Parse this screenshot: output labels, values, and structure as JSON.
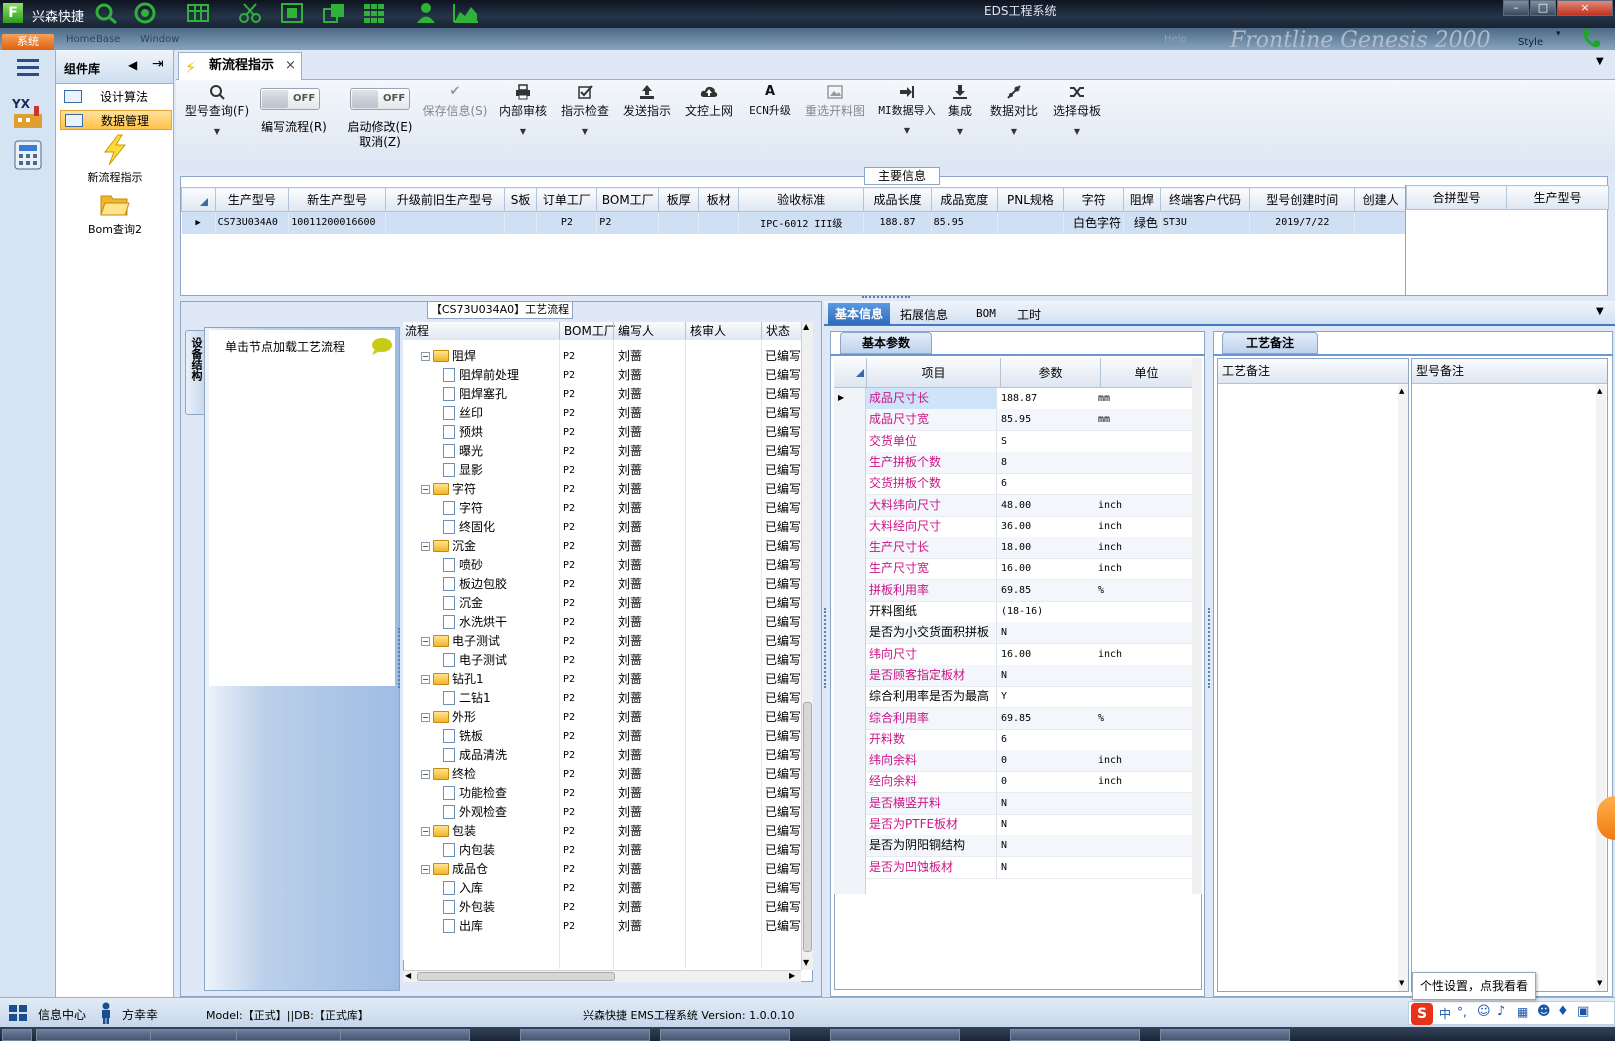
{
  "app": {
    "name": "兴森快捷",
    "window_title": "EDS工程系统",
    "window_buttons": [
      "–",
      "□",
      "×"
    ],
    "quick_icons": [
      "search-icon",
      "target-icon",
      "grid-icon",
      "scissors-icon",
      "film-icon",
      "copy-icon",
      "table-icon",
      "user-icon",
      "chart-icon"
    ]
  },
  "ribbon": {
    "system_tab": "系统",
    "menus": [
      "Home",
      "Base",
      "Window"
    ],
    "right_faded": "Help",
    "watermark": "Frontline  Genesis 2000",
    "style_label": "Style"
  },
  "left_toolbar": {
    "icons": [
      "menu-icon",
      "factory-icon",
      "calculator-icon"
    ],
    "factory_text": "YX"
  },
  "component_library": {
    "title": "组件库",
    "items": [
      {
        "label": "设计算法",
        "selected": false
      },
      {
        "label": "数据管理",
        "selected": true
      }
    ],
    "buttons": [
      {
        "label": "新流程指示",
        "icon": "lightning-icon"
      },
      {
        "label": "Bom查询2",
        "icon": "folder-open-icon"
      }
    ]
  },
  "doc_tab": {
    "label": "新流程指示",
    "close": "×"
  },
  "toolbar": {
    "items": [
      {
        "label": "型号查询(F)",
        "icon": "search-icon",
        "disabled": false,
        "dropdown": true
      },
      {
        "label": "编写流程(R)",
        "toggle": "OFF"
      },
      {
        "label": "启动修改(E)",
        "toggle": "OFF",
        "sub": "取消(Z)"
      },
      {
        "label": "保存信息(S)",
        "icon": "check-icon",
        "disabled": true
      },
      {
        "label": "内部审核",
        "icon": "printer-icon",
        "disabled": false,
        "dropdown": true
      },
      {
        "label": "指示检查",
        "icon": "checkbox-icon",
        "disabled": false,
        "dropdown": true
      },
      {
        "label": "发送指示",
        "icon": "upload-icon",
        "disabled": false
      },
      {
        "label": "文控上网",
        "icon": "cloud-upload-icon",
        "disabled": false
      },
      {
        "label": "ECN升级",
        "icon": "font-icon",
        "disabled": false
      },
      {
        "label": "重选开料图",
        "icon": "image-icon",
        "disabled": true
      },
      {
        "label": "MI数据导入",
        "icon": "import-icon",
        "disabled": false,
        "dropdown": true
      },
      {
        "label": "集成",
        "icon": "download-icon",
        "disabled": false,
        "dropdown": true
      },
      {
        "label": "数据对比",
        "icon": "compare-icon",
        "disabled": false,
        "dropdown": true
      },
      {
        "label": "选择母板",
        "icon": "shuffle-icon",
        "disabled": false,
        "dropdown": true
      }
    ]
  },
  "main_info": {
    "legend": "主要信息",
    "columns": [
      "生产型号",
      "新生产型号",
      "升级前旧生产型号",
      "S板",
      "订单工厂",
      "BOM工厂",
      "板厚",
      "板材",
      "验收标准",
      "成品长度",
      "成品宽度",
      "PNL规格",
      "字符",
      "阻焊",
      "终端客户代码",
      "型号创建时间",
      "创建人"
    ],
    "rows": [
      [
        "CS73U034A0",
        "10011200016600",
        "",
        "",
        "P2",
        "P2",
        "",
        "",
        "IPC-6012 III级",
        "188.87",
        "85.95",
        "",
        "白色字符",
        "绿色",
        "ST3U",
        "2019/7/22",
        ""
      ]
    ],
    "side_columns": [
      "合拼型号",
      "生产型号"
    ]
  },
  "process": {
    "side_tab": "设备结构",
    "click_hint": "单击节点加载工艺流程",
    "legend": "【CS73U034A0】工艺流程",
    "columns": [
      "流程",
      "BOM工厂",
      "编写人",
      "核审人",
      "状态"
    ],
    "rows": [
      {
        "name": "阻焊",
        "level": 0,
        "factory": "P2",
        "writer": "刘蔷",
        "reviewer": "",
        "status": "已编写"
      },
      {
        "name": "阻焊前处理",
        "level": 1,
        "factory": "P2",
        "writer": "刘蔷",
        "reviewer": "",
        "status": "已编写"
      },
      {
        "name": "阻焊塞孔",
        "level": 1,
        "factory": "P2",
        "writer": "刘蔷",
        "reviewer": "",
        "status": "已编写"
      },
      {
        "name": "丝印",
        "level": 1,
        "factory": "P2",
        "writer": "刘蔷",
        "reviewer": "",
        "status": "已编写"
      },
      {
        "name": "预烘",
        "level": 1,
        "factory": "P2",
        "writer": "刘蔷",
        "reviewer": "",
        "status": "已编写"
      },
      {
        "name": "曝光",
        "level": 1,
        "factory": "P2",
        "writer": "刘蔷",
        "reviewer": "",
        "status": "已编写"
      },
      {
        "name": "显影",
        "level": 1,
        "factory": "P2",
        "writer": "刘蔷",
        "reviewer": "",
        "status": "已编写"
      },
      {
        "name": "字符",
        "level": 0,
        "factory": "P2",
        "writer": "刘蔷",
        "reviewer": "",
        "status": "已编写"
      },
      {
        "name": "字符",
        "level": 1,
        "factory": "P2",
        "writer": "刘蔷",
        "reviewer": "",
        "status": "已编写"
      },
      {
        "name": "终固化",
        "level": 1,
        "factory": "P2",
        "writer": "刘蔷",
        "reviewer": "",
        "status": "已编写"
      },
      {
        "name": "沉金",
        "level": 0,
        "factory": "P2",
        "writer": "刘蔷",
        "reviewer": "",
        "status": "已编写"
      },
      {
        "name": "喷砂",
        "level": 1,
        "factory": "P2",
        "writer": "刘蔷",
        "reviewer": "",
        "status": "已编写"
      },
      {
        "name": "板边包胶",
        "level": 1,
        "factory": "P2",
        "writer": "刘蔷",
        "reviewer": "",
        "status": "已编写"
      },
      {
        "name": "沉金",
        "level": 1,
        "factory": "P2",
        "writer": "刘蔷",
        "reviewer": "",
        "status": "已编写"
      },
      {
        "name": "水洗烘干",
        "level": 1,
        "factory": "P2",
        "writer": "刘蔷",
        "reviewer": "",
        "status": "已编写"
      },
      {
        "name": "电子测试",
        "level": 0,
        "factory": "P2",
        "writer": "刘蔷",
        "reviewer": "",
        "status": "已编写"
      },
      {
        "name": "电子测试",
        "level": 1,
        "factory": "P2",
        "writer": "刘蔷",
        "reviewer": "",
        "status": "已编写"
      },
      {
        "name": "钻孔1",
        "level": 0,
        "factory": "P2",
        "writer": "刘蔷",
        "reviewer": "",
        "status": "已编写"
      },
      {
        "name": "二钻1",
        "level": 1,
        "factory": "P2",
        "writer": "刘蔷",
        "reviewer": "",
        "status": "已编写"
      },
      {
        "name": "外形",
        "level": 0,
        "factory": "P2",
        "writer": "刘蔷",
        "reviewer": "",
        "status": "已编写"
      },
      {
        "name": "铣板",
        "level": 1,
        "factory": "P2",
        "writer": "刘蔷",
        "reviewer": "",
        "status": "已编写"
      },
      {
        "name": "成品清洗",
        "level": 1,
        "factory": "P2",
        "writer": "刘蔷",
        "reviewer": "",
        "status": "已编写"
      },
      {
        "name": "终检",
        "level": 0,
        "factory": "P2",
        "writer": "刘蔷",
        "reviewer": "",
        "status": "已编写"
      },
      {
        "name": "功能检查",
        "level": 1,
        "factory": "P2",
        "writer": "刘蔷",
        "reviewer": "",
        "status": "已编写"
      },
      {
        "name": "外观检查",
        "level": 1,
        "factory": "P2",
        "writer": "刘蔷",
        "reviewer": "",
        "status": "已编写"
      },
      {
        "name": "包装",
        "level": 0,
        "factory": "P2",
        "writer": "刘蔷",
        "reviewer": "",
        "status": "已编写"
      },
      {
        "name": "内包装",
        "level": 1,
        "factory": "P2",
        "writer": "刘蔷",
        "reviewer": "",
        "status": "已编写"
      },
      {
        "name": "成品仓",
        "level": 0,
        "factory": "P2",
        "writer": "刘蔷",
        "reviewer": "",
        "status": "已编写"
      },
      {
        "name": "入库",
        "level": 1,
        "factory": "P2",
        "writer": "刘蔷",
        "reviewer": "",
        "status": "已编写"
      },
      {
        "name": "外包装",
        "level": 1,
        "factory": "P2",
        "writer": "刘蔷",
        "reviewer": "",
        "status": "已编写"
      },
      {
        "name": "出库",
        "level": 1,
        "factory": "P2",
        "writer": "刘蔷",
        "reviewer": "",
        "status": "已编写"
      }
    ]
  },
  "detail_tabs": [
    "基本信息",
    "拓展信息",
    "BOM",
    "工时"
  ],
  "basic_params": {
    "title": "基本参数",
    "columns": [
      "项目",
      "参数",
      "单位"
    ],
    "rows": [
      {
        "name": "成品尺寸长",
        "value": "188.87",
        "unit": "mm",
        "red": true
      },
      {
        "name": "成品尺寸宽",
        "value": "85.95",
        "unit": "mm",
        "red": true
      },
      {
        "name": "交货单位",
        "value": "S",
        "unit": "",
        "red": true
      },
      {
        "name": "生产拼板个数",
        "value": "8",
        "unit": "",
        "red": true
      },
      {
        "name": "交货拼板个数",
        "value": "6",
        "unit": "",
        "red": true
      },
      {
        "name": "大料纬向尺寸",
        "value": "48.00",
        "unit": "inch",
        "red": true
      },
      {
        "name": "大料经向尺寸",
        "value": "36.00",
        "unit": "inch",
        "red": true
      },
      {
        "name": "生产尺寸长",
        "value": "18.00",
        "unit": "inch",
        "red": true
      },
      {
        "name": "生产尺寸宽",
        "value": "16.00",
        "unit": "inch",
        "red": true
      },
      {
        "name": "拼板利用率",
        "value": "69.85",
        "unit": "%",
        "red": true
      },
      {
        "name": "开料图纸",
        "value": "(18-16)",
        "unit": "",
        "red": false
      },
      {
        "name": "是否为小交货面积拼板",
        "value": "N",
        "unit": "",
        "red": false
      },
      {
        "name": "纬向尺寸",
        "value": "16.00",
        "unit": "inch",
        "red": true
      },
      {
        "name": "是否顾客指定板材",
        "value": "N",
        "unit": "",
        "red": true
      },
      {
        "name": "综合利用率是否为最高",
        "value": "Y",
        "unit": "",
        "red": false
      },
      {
        "name": "综合利用率",
        "value": "69.85",
        "unit": "%",
        "red": true
      },
      {
        "name": "开料数",
        "value": "6",
        "unit": "",
        "red": true
      },
      {
        "name": "纬向余料",
        "value": "0",
        "unit": "inch",
        "red": true
      },
      {
        "name": "经向余料",
        "value": "0",
        "unit": "inch",
        "red": true
      },
      {
        "name": "是否横竖开料",
        "value": "N",
        "unit": "",
        "red": true
      },
      {
        "name": "是否为PTFE板材",
        "value": "N",
        "unit": "",
        "red": true
      },
      {
        "name": "是否为阴阳铜结构",
        "value": "N",
        "unit": "",
        "red": false
      },
      {
        "name": "是否为凹蚀板材",
        "value": "N",
        "unit": "",
        "red": true
      }
    ]
  },
  "process_notes": {
    "title": "工艺备注",
    "columns": [
      "工艺备注",
      "型号备注"
    ]
  },
  "tooltip": "个性设置，点我看看",
  "status_bar": {
    "info_center": "信息中心",
    "user": "方幸幸",
    "model_info": "Model:【正式】||DB:【正式库】",
    "version": "兴森快捷 EMS工程系统 Version: 1.0.0.10"
  },
  "colors": {
    "accent": "#2e76c2",
    "selected_row": "#cfe0f5",
    "highlight_name": "#cde4fa",
    "red_label": "#cc1488",
    "nav_selected": "#ffc24a",
    "orange_tab": "#e0600d"
  }
}
